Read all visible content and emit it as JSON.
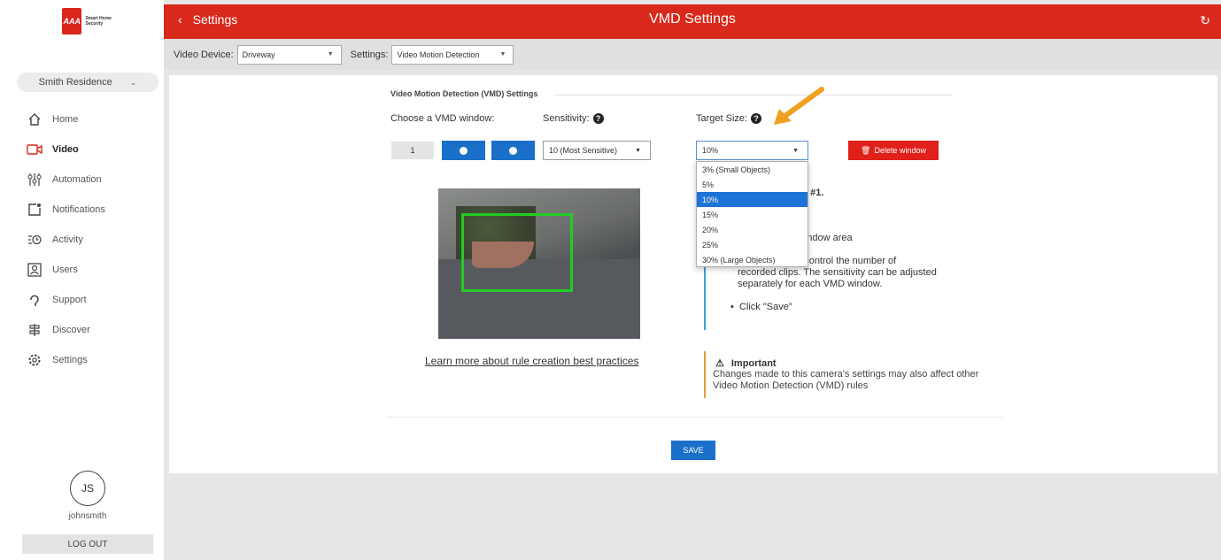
{
  "brand": {
    "logo_mark": "AAA",
    "logo_text": "Smart Home Security"
  },
  "sidebar": {
    "residence": "Smith Residence",
    "items": [
      {
        "label": "Home",
        "icon": "home-icon"
      },
      {
        "label": "Video",
        "icon": "video-icon",
        "active": true
      },
      {
        "label": "Automation",
        "icon": "sliders-icon"
      },
      {
        "label": "Notifications",
        "icon": "bell-square-icon"
      },
      {
        "label": "Activity",
        "icon": "activity-icon"
      },
      {
        "label": "Users",
        "icon": "user-icon"
      },
      {
        "label": "Support",
        "icon": "headset-icon"
      },
      {
        "label": "Discover",
        "icon": "signpost-icon"
      },
      {
        "label": "Settings",
        "icon": "gear-icon"
      }
    ],
    "avatar_initials": "JS",
    "username": "johnsmith",
    "logout": "LOG OUT"
  },
  "header": {
    "back_label": "Settings",
    "title": "VMD Settings"
  },
  "subbar": {
    "video_device_label": "Video Device:",
    "video_device_value": "Driveway",
    "settings_label": "Settings:",
    "settings_value": "Video Motion Detection"
  },
  "vmd": {
    "section_title": "Video Motion Detection (VMD) Settings",
    "choose_window_label": "Choose a VMD window:",
    "window_number": "1",
    "sensitivity_label": "Sensitivity:",
    "sensitivity_value": "10 (Most Sensitive)",
    "target_size_label": "Target Size:",
    "target_size_value": "10%",
    "delete_window": "Delete window",
    "target_options": [
      "3% (Small Objects)",
      "5%",
      "10%",
      "15%",
      "20%",
      "25%",
      "30% (Large Objects)"
    ],
    "selected_option": "10%",
    "learn_more": "Learn more about rule creation best practices",
    "instr_title": "ting VMD window #1.",
    "instr_redraw": "o re-draw the window area",
    "instr_sensitivity_1": "itivity setting to control the number of",
    "instr_sensitivity_2": "recorded clips. The sensitivity can be adjusted",
    "instr_sensitivity_3": "separately for each VMD window.",
    "instr_save": "Click \"Save\"",
    "important_title": "Important",
    "important_text": "Changes made to this camera's settings may also affect other Video Motion Detection (VMD) rules",
    "save": "SAVE"
  },
  "colors": {
    "brand_red": "#d9291c",
    "primary_blue": "#1a6fc9",
    "vmd_box": "#22cc22",
    "annotation_arrow": "#f0a020"
  }
}
